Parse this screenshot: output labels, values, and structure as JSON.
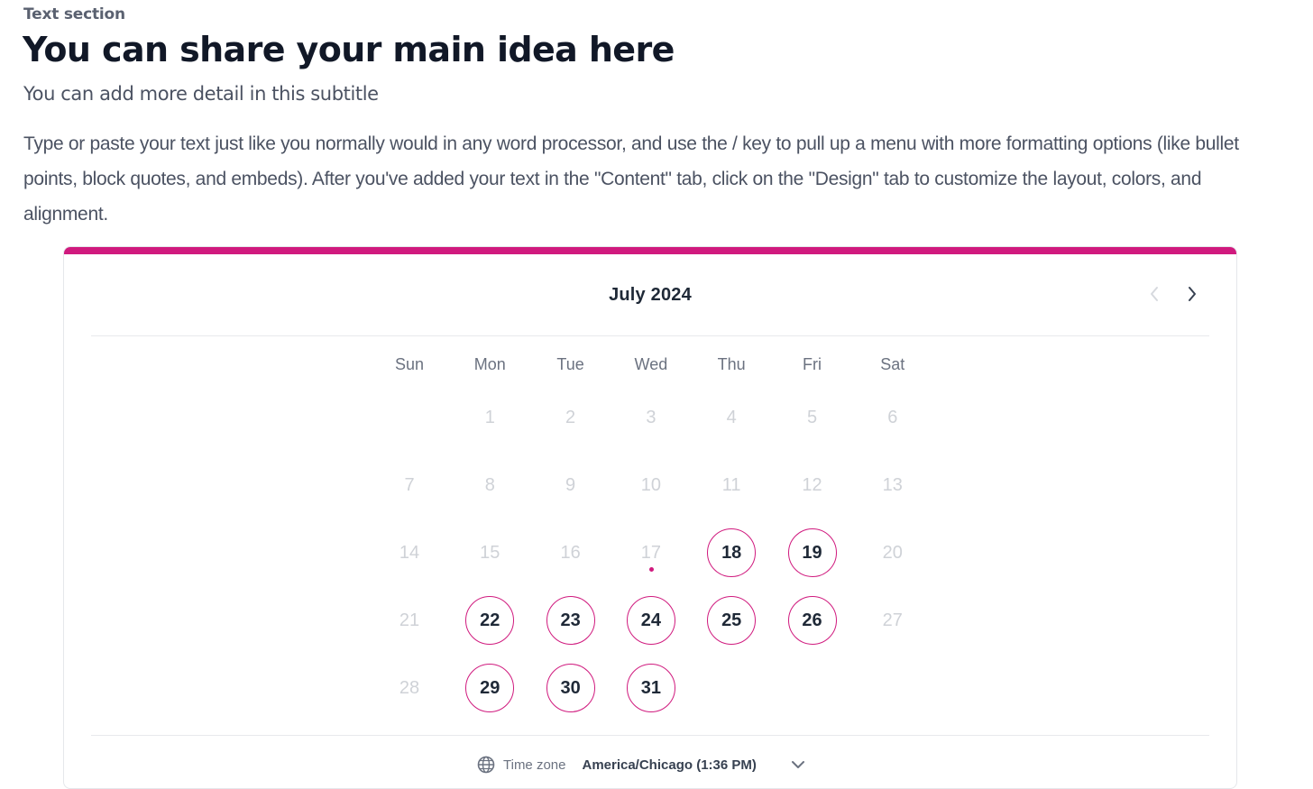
{
  "section_label": "Text section",
  "headline": "You can share your main idea here",
  "subtitle": "You can add more detail in this subtitle",
  "body_text": "Type or paste your text just like you normally would in any word processor, and use the / key to pull up a menu with more formatting options (like bullet points, block quotes, and embeds). After you've added your text in the \"Content\" tab, click on the \"Design\" tab to customize the layout, colors, and alignment.",
  "calendar": {
    "month_label": "July 2024",
    "accent_color": "#d01a7e",
    "prev_icon": "chevron-left-icon",
    "next_icon": "chevron-right-icon",
    "weekdays": [
      "Sun",
      "Mon",
      "Tue",
      "Wed",
      "Thu",
      "Fri",
      "Sat"
    ],
    "first_weekday_index": 1,
    "days_in_month": 31,
    "today": 17,
    "available_days": [
      18,
      19,
      22,
      23,
      24,
      25,
      26,
      29,
      30,
      31
    ],
    "timezone_label": "Time zone",
    "timezone_value": "America/Chicago (1:36 PM)"
  }
}
